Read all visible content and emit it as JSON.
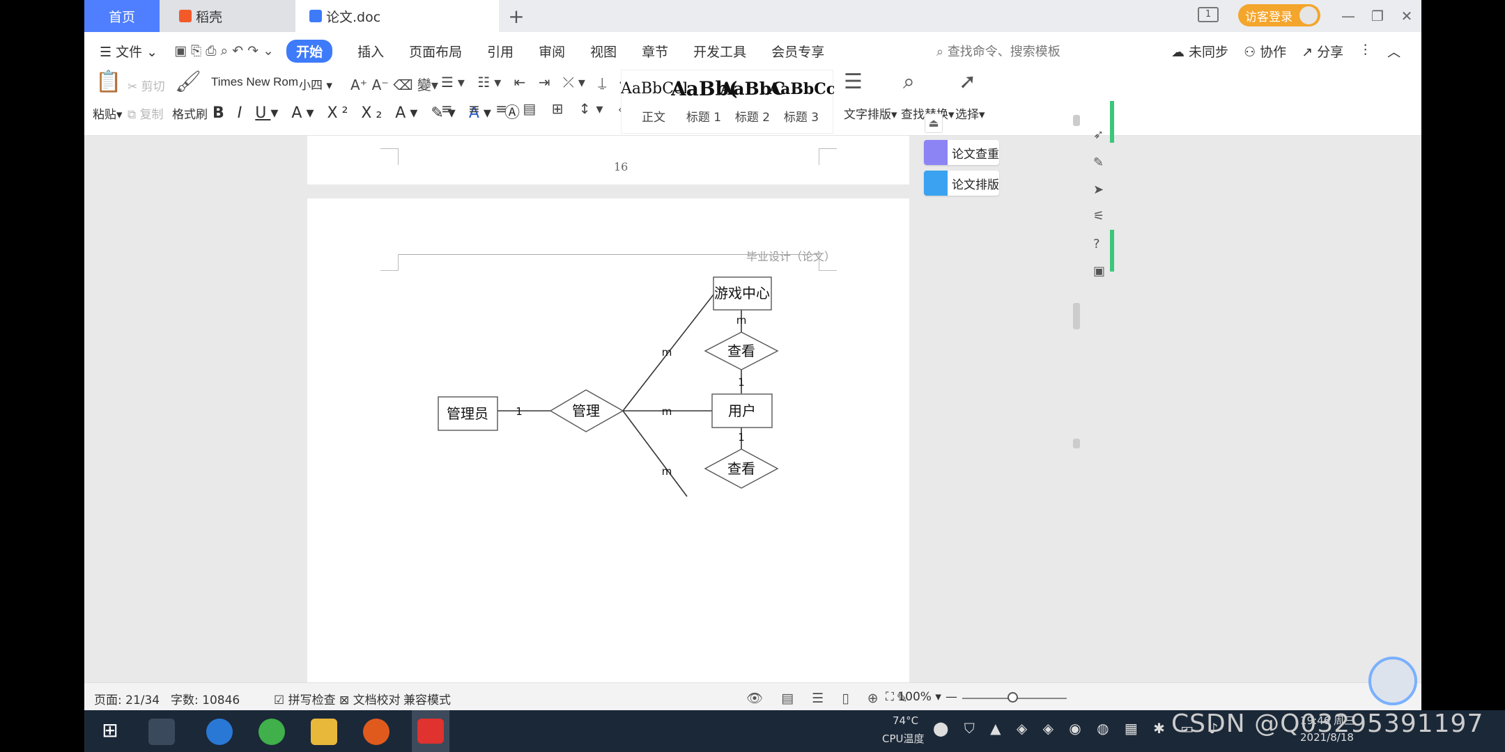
{
  "tabs": {
    "home": "首页",
    "daoke": "稻壳",
    "doc": "论文.doc",
    "plus": "+"
  },
  "titlebar": {
    "page_indicator": "1",
    "login": "访客登录"
  },
  "menu": {
    "file": "文件",
    "items": [
      "开始",
      "插入",
      "页面布局",
      "引用",
      "审阅",
      "视图",
      "章节",
      "开发工具",
      "会员专享"
    ],
    "search_placeholder": "查找命令、搜索模板",
    "sync": "未同步",
    "collab": "协作",
    "share": "分享"
  },
  "ribbon": {
    "paste": "粘贴",
    "cut": "剪切",
    "copy": "复制",
    "format_painter": "格式刷",
    "font": "Times New Roma",
    "size": "小四",
    "styles": [
      {
        "sample": "AaBbCcI",
        "label": "正文"
      },
      {
        "sample": "AaBb(",
        "label": "标题 1"
      },
      {
        "sample": "AaBbC",
        "label": "标题 2"
      },
      {
        "sample": "AaBbCcl",
        "label": "标题 3"
      }
    ],
    "text_layout": "文字排版",
    "find_replace": "查找替换",
    "select": "选择"
  },
  "document": {
    "page_number": "16",
    "header": "毕业设计（论文）",
    "diagram": {
      "entities": [
        "游戏中心",
        "管理员",
        "用户"
      ],
      "relations": [
        "查看",
        "管理",
        "查看"
      ],
      "cardinalities": [
        "m",
        "1",
        "1",
        "m",
        "m",
        "1",
        "m"
      ]
    }
  },
  "side_panel": {
    "check": "论文查重",
    "layout": "论文排版"
  },
  "status": {
    "page": "页面: 21/34",
    "words": "字数: 10846",
    "spell": "拼写检查",
    "proof": "文档校对",
    "compat": "兼容模式",
    "zoom": "100%"
  },
  "taskbar": {
    "temp": "74°C",
    "cpu": "CPU温度",
    "date": "2021/8/18",
    "time": "19:46 周三"
  },
  "watermark": "CSDN @Q032953911​97"
}
